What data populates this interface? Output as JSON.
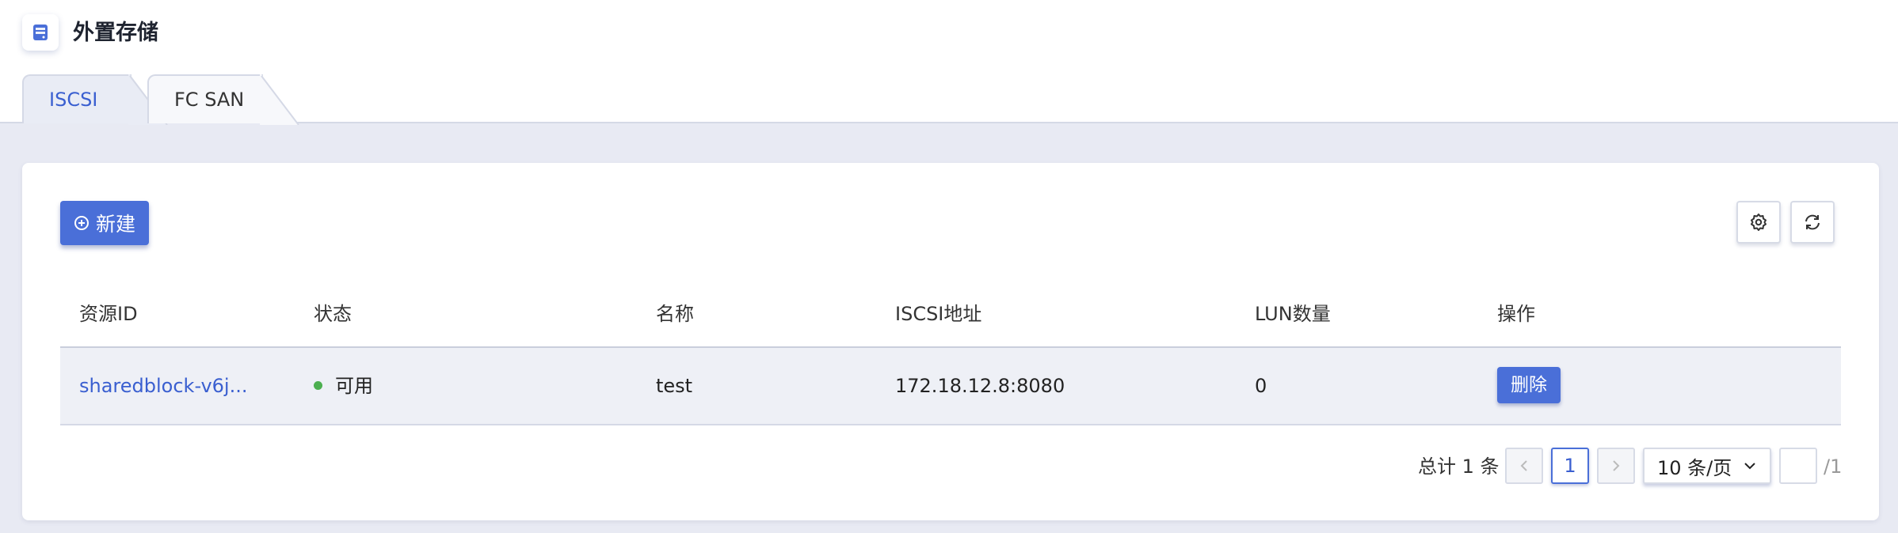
{
  "header": {
    "title": "外置存储",
    "icon": "storage-icon",
    "accent": "#4a6fd8"
  },
  "tabs": [
    {
      "label": "ISCSI",
      "active": true
    },
    {
      "label": "FC SAN",
      "active": false
    }
  ],
  "toolbar": {
    "new_label": "新建",
    "settings_icon": "gear-icon",
    "refresh_icon": "refresh-icon"
  },
  "table": {
    "columns": [
      "资源ID",
      "状态",
      "名称",
      "ISCSI地址",
      "LUN数量",
      "操作"
    ],
    "rows": [
      {
        "resource_id": "sharedblock-v6j...",
        "status": "可用",
        "status_color": "#4caf50",
        "name": "test",
        "iscsi_address": "172.18.12.8:8080",
        "lun_count": "0",
        "action_delete": "删除"
      }
    ]
  },
  "pagination": {
    "total_text": "总计 1 条",
    "current_page": "1",
    "page_size": "10 条/页",
    "jump_value": "",
    "total_pages_suffix": "/1"
  }
}
